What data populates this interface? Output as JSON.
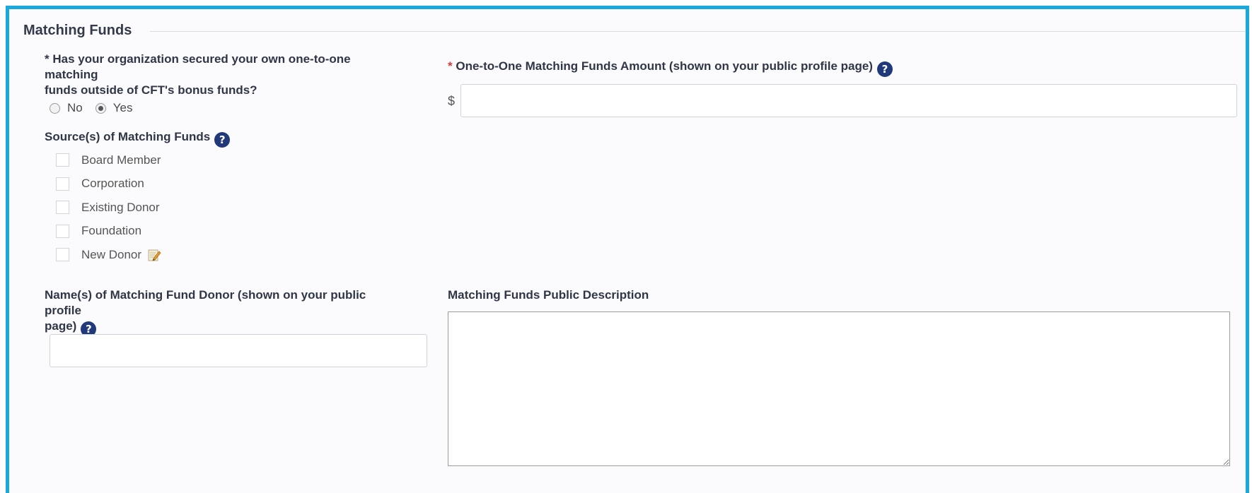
{
  "section": {
    "title": "Matching Funds"
  },
  "secured_question": {
    "required_mark": "*",
    "label_line1": "Has your organization secured your own one-to-one matching",
    "label_line2": "funds outside of CFT's bonus funds?",
    "options": [
      {
        "label": "No",
        "checked": false
      },
      {
        "label": "Yes",
        "checked": true
      }
    ]
  },
  "amount": {
    "required_mark": "*",
    "label": "One-to-One Matching Funds Amount (shown on your public profile page)",
    "currency_symbol": "$",
    "value": "",
    "help_icon": "question-circle-icon"
  },
  "sources": {
    "label": "Source(s) of Matching Funds",
    "help_icon": "question-circle-icon",
    "items": [
      {
        "label": "Board Member",
        "checked": false
      },
      {
        "label": "Corporation",
        "checked": false
      },
      {
        "label": "Existing Donor",
        "checked": false
      },
      {
        "label": "Foundation",
        "checked": false
      },
      {
        "label": "New Donor",
        "checked": false,
        "icon": "edit-note-icon"
      }
    ]
  },
  "donor_names": {
    "label_line1": "Name(s) of Matching Fund Donor (shown on your public profile",
    "label_line2": "page)",
    "value": "",
    "help_icon": "question-circle-icon"
  },
  "public_description": {
    "label": "Matching Funds Public Description",
    "value": ""
  },
  "colors": {
    "frame_border": "#19a9dd",
    "help_icon": "#21397a",
    "required_red": "#d23b3b"
  }
}
